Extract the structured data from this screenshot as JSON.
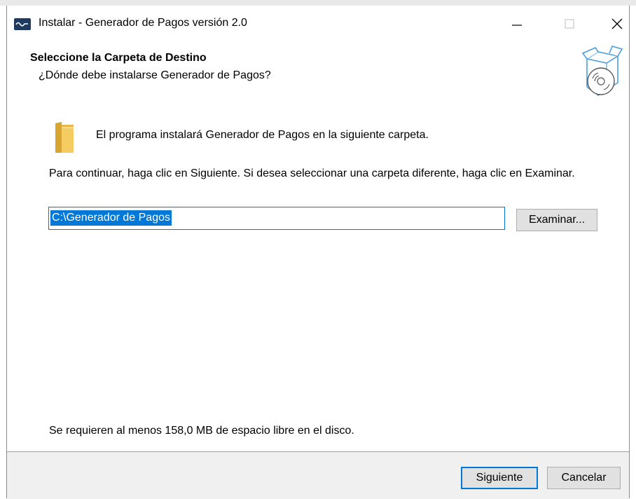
{
  "window": {
    "title": "Instalar - Generador de Pagos versión 2.0"
  },
  "header": {
    "title": "Seleccione la Carpeta de Destino",
    "subtitle": "¿Dónde debe instalarse Generador de Pagos?"
  },
  "content": {
    "info": "El programa instalará Generador de Pagos en la siguiente carpeta.",
    "instructions": "Para continuar, haga clic en Siguiente. Si desea seleccionar una carpeta diferente, haga clic en Examinar.",
    "path_value": "C:\\Generador de Pagos",
    "browse_label": "Examinar...",
    "disk_space": "Se requieren al menos 158,0 MB de espacio libre en el disco."
  },
  "footer": {
    "next_label": "Siguiente",
    "cancel_label": "Cancelar"
  },
  "colors": {
    "accent": "#0078d7",
    "app_icon": "#1f3a5f",
    "box_icon": "#4a9fe0"
  },
  "icons": {
    "app": "installer-app-icon",
    "header": "software-box-cd-icon",
    "folder": "folder-icon",
    "minimize": "minimize-icon",
    "maximize": "maximize-icon",
    "close": "close-icon"
  }
}
